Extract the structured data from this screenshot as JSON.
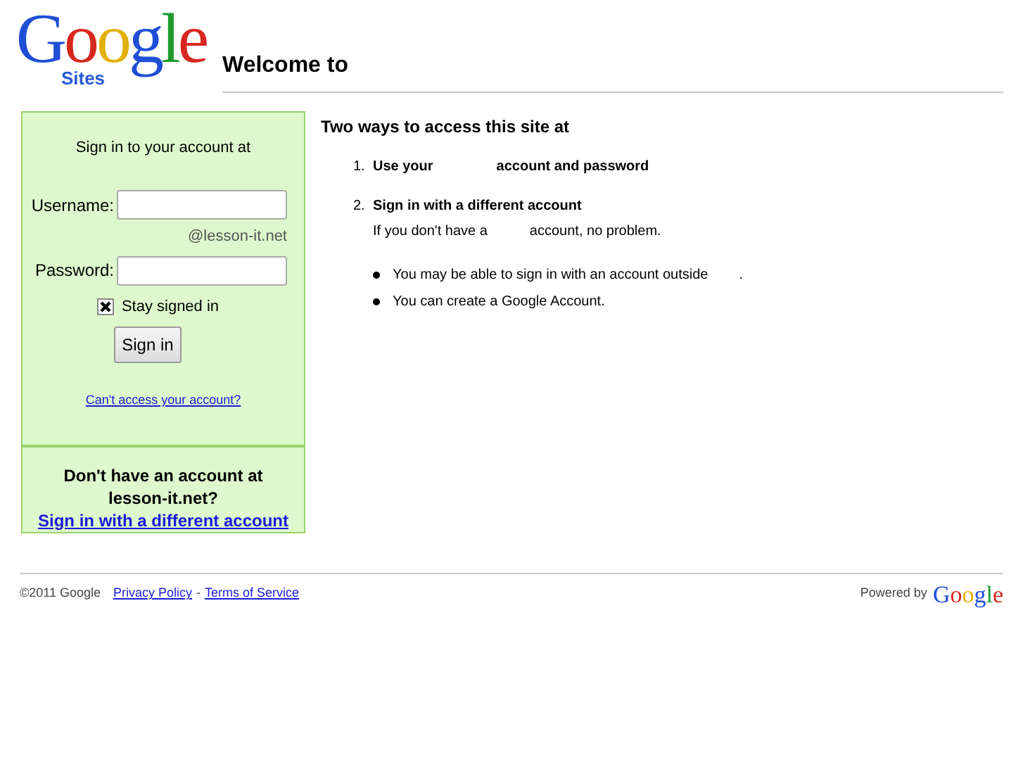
{
  "logo": {
    "word": "Google",
    "product": "Sites"
  },
  "page_title": "Welcome to",
  "signin": {
    "heading": "Sign in to your account at",
    "fields": [
      {
        "label": "Username:",
        "suffix": "@lesson-it.net"
      },
      {
        "label": "Password:"
      }
    ],
    "stay_signed_in": {
      "label": "Stay signed in",
      "checked": true
    },
    "button": "Sign in",
    "help_link": "Can't access your account?",
    "no_account": "Don't have an account at lesson-it.net?",
    "different_link": "Sign in with a different account"
  },
  "access": {
    "title": "Two ways to access this site at",
    "steps": [
      {
        "number": "1.",
        "title_parts": [
          "Use your",
          "account and password"
        ]
      },
      {
        "number": "2.",
        "title_parts": [
          "Sign in with a different account"
        ],
        "note_parts": [
          "If you don't have a",
          "account, no problem."
        ],
        "bullets": [
          [
            "You may be able to sign in with an account outside",
            "."
          ],
          [
            "You can create a Google Account."
          ]
        ]
      }
    ]
  },
  "footer": {
    "copyright": "©2011 Google",
    "links": [
      "Privacy Policy",
      "Terms of Service"
    ],
    "separator": "-",
    "powered_by": "Powered by",
    "powered_logo": "Google"
  }
}
